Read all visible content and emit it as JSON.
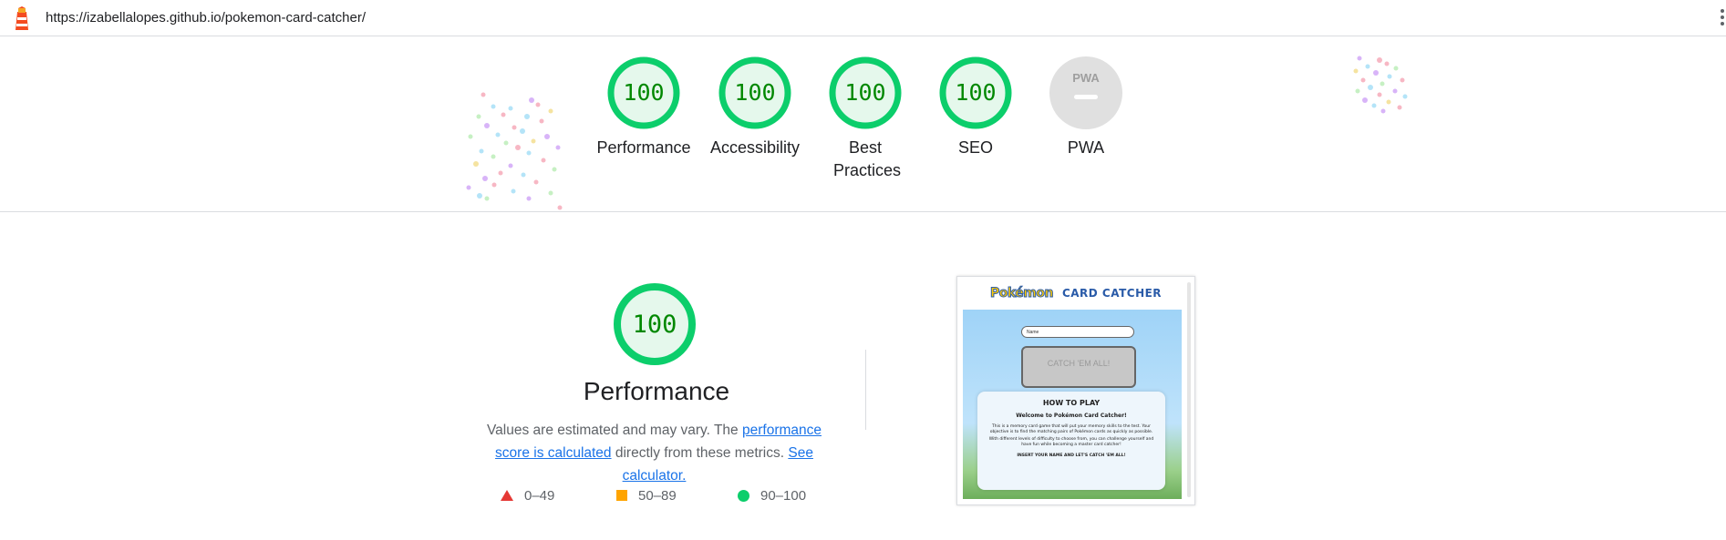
{
  "browser": {
    "url": "https://izabellalopes.github.io/pokemon-card-catcher/",
    "logo_icon": "lighthouse-icon",
    "menu_icon": "more-vert-icon"
  },
  "header_scores": [
    {
      "label": "Performance",
      "score": "100"
    },
    {
      "label": "Accessibility",
      "score": "100"
    },
    {
      "label": "Best Practices",
      "score": "100"
    },
    {
      "label": "SEO",
      "score": "100"
    },
    {
      "label": "PWA",
      "score": "PWA"
    }
  ],
  "performance": {
    "score": "100",
    "title": "Performance",
    "desc_prefix": "Values are estimated and may vary. The ",
    "link_score": "performance score is calculated",
    "desc_middle": " directly from these metrics. ",
    "link_calc": "See calculator."
  },
  "legend": [
    {
      "icon": "triangle-icon",
      "range": "0–49",
      "color": "#e53935"
    },
    {
      "icon": "square-icon",
      "range": "50–89",
      "color": "#ffa400"
    },
    {
      "icon": "circle-icon",
      "range": "90–100",
      "color": "#0cce6b"
    }
  ],
  "screenshot": {
    "logo_text": "Pokémon",
    "title": "CARD CATCHER",
    "input_placeholder": "Name",
    "button_label": "CATCH 'EM ALL!",
    "card_heading": "HOW TO PLAY",
    "card_welcome": "Welcome to Pokémon Card Catcher!",
    "card_text_1": "This is a memory card game that will put your memory skills to the test. Your objective is to find the matching pairs of Pokémon cards as quickly as possible.",
    "card_text_2": "With different levels of difficulty to choose from, you can challenge yourself and have fun while becoming a master card catcher!",
    "card_cta": "INSERT YOUR NAME AND LET'S CATCH 'EM ALL!"
  },
  "colors": {
    "pass_green": "#0cce6b",
    "pass_text": "#008800",
    "pass_fill": "#e5f8ec",
    "na_gray": "#e0e0e0",
    "link_blue": "#1a73e8"
  }
}
